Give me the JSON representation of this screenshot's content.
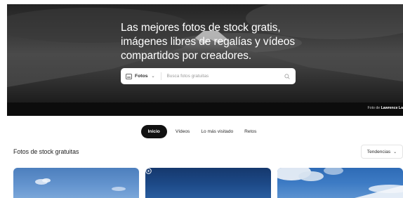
{
  "hero": {
    "title_line1": "Las mejores fotos de stock gratis,",
    "title_line2": "imágenes libres de regalías y vídeos",
    "title_line3": "compartidos por creadores.",
    "search": {
      "type_label": "Fotos",
      "placeholder": "Busca fotos gratuitas",
      "icon": "search-icon"
    },
    "credit_prefix": "Foto de ",
    "credit_author": "Lawrence La"
  },
  "tabs": [
    {
      "label": "Inicio",
      "active": true
    },
    {
      "label": "Vídeos",
      "active": false
    },
    {
      "label": "Lo más visitado",
      "active": false
    },
    {
      "label": "Retos",
      "active": false
    }
  ],
  "section": {
    "title": "Fotos de stock gratuitas",
    "sort_label": "Tendencias"
  },
  "cards": [
    {
      "kind": "photo"
    },
    {
      "kind": "video",
      "icon": "play-circle-icon"
    },
    {
      "kind": "photo"
    }
  ],
  "colors": {
    "active_tab": "#111111",
    "hero_text": "#ffffff"
  }
}
